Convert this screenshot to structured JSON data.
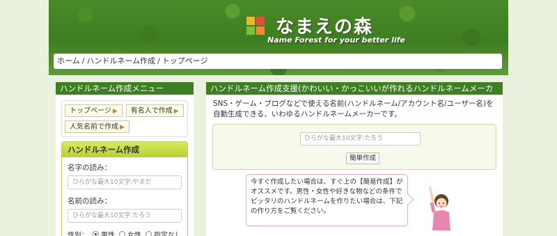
{
  "header": {
    "title": "なまえの森",
    "subtitle": "Name Forest for your better life",
    "logo_colors": [
      "#f0b72f",
      "#e94e3c",
      "#7bbf3a",
      "#f08a2a"
    ]
  },
  "breadcrumb": [
    "ホーム",
    "ハンドルネーム作成",
    "トップページ"
  ],
  "sidebar": {
    "menu_title": "ハンドルネーム作成メニュー",
    "nav": [
      {
        "label": "トップページ"
      },
      {
        "label": "有名人で作成"
      },
      {
        "label": "人気名前で作成"
      }
    ],
    "maker": {
      "title": "ハンドルネーム作成",
      "surname_label": "名字の読み：",
      "surname_placeholder": "ひらがな最大10文字:やまだ",
      "firstname_label": "名前の読み：",
      "firstname_placeholder": "ひらがな最大10文字:たろう",
      "gender_label": "性別：",
      "gender_options": [
        "男性",
        "女性",
        "指定なし"
      ],
      "gender_selected": "男性"
    }
  },
  "main": {
    "title": "ハンドルネーム作成支援(かわいい・かっこいいが作れるハンドルネームメーカー)",
    "description": "SNS・ゲーム・ブログなどで使える名前(ハンドルネーム/アカウント名/ユーザー名)を自動生成できる、いわゆるハンドルネームメーカーです。",
    "quick_placeholder": "ひらがな最大10文字:たろう",
    "quick_button": "簡単作成",
    "bubble_text": "今すぐ作成したい場合は、すぐ上の【簡易作成】がオススメです。男性・女性や好きな物などの条件でピッタリのハンドルネームを作りたい場合は、下記の作り方をご覧ください。"
  },
  "colors": {
    "header_green": "#3e7f24",
    "maker_head": "#c4da44",
    "bubble_border": "#e8a6c2"
  }
}
